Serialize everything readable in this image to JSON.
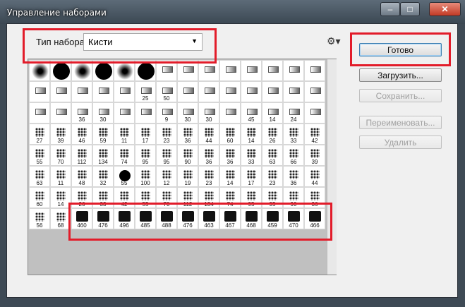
{
  "window": {
    "title": "Управление наборами"
  },
  "preset": {
    "type_label": "Тип набора:",
    "type_value": "Кисти"
  },
  "buttons": {
    "done": "Готово",
    "load": "Загрузить...",
    "save": "Сохранить...",
    "rename": "Переименовать...",
    "delete": "Удалить"
  },
  "grid_rows": [
    [
      "",
      "",
      "",
      "",
      "",
      "",
      "",
      "",
      "",
      "",
      "",
      "",
      ""
    ],
    [
      "",
      "",
      "",
      "",
      "",
      "25",
      "50",
      "",
      "",
      "",
      "",
      "",
      ""
    ],
    [
      "",
      "",
      "36",
      "30",
      "",
      "",
      "9",
      "30",
      "30",
      "",
      "45",
      "14",
      "24"
    ],
    [
      "27",
      "39",
      "46",
      "59",
      "11",
      "17",
      "23",
      "36",
      "44",
      "60",
      "14",
      "26",
      "33",
      "42"
    ],
    [
      "55",
      "70",
      "112",
      "134",
      "74",
      "95",
      "95",
      "90",
      "36",
      "36",
      "33",
      "63",
      "66",
      "39"
    ],
    [
      "63",
      "11",
      "48",
      "32",
      "55",
      "100",
      "12",
      "19",
      "23",
      "14",
      "17",
      "23",
      "36",
      "44"
    ],
    [
      "60",
      "14",
      "26",
      "33",
      "42",
      "55",
      "70",
      "112",
      "134",
      "74",
      "95",
      "95",
      "90",
      "36"
    ],
    [
      "56",
      "68",
      "460",
      "476",
      "496",
      "485",
      "488",
      "476",
      "463",
      "467",
      "468",
      "459",
      "470",
      "466"
    ]
  ],
  "colors": {
    "highlight": "#e21c2a"
  }
}
